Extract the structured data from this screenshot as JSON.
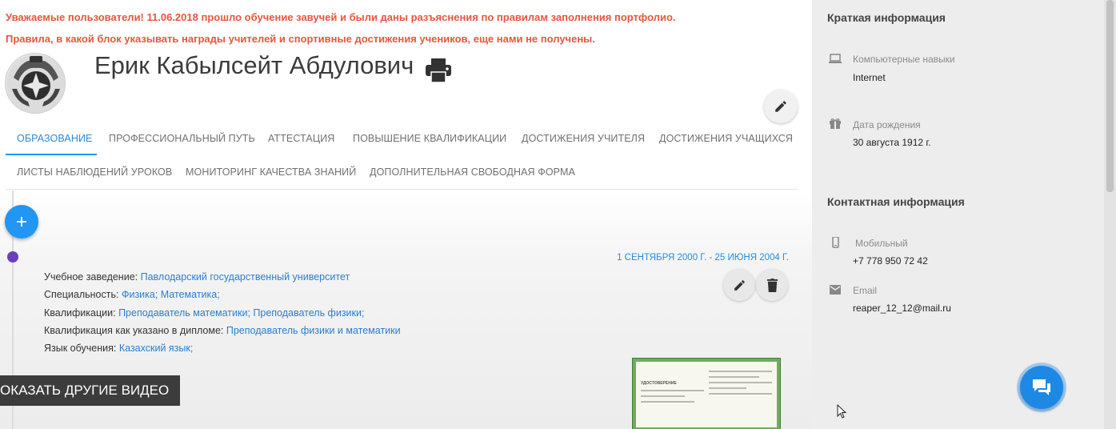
{
  "notices": [
    "Уважаемые пользователи! 11.06.2018 прошло обучение завучей и были даны разъяснения по правилам заполнения портфолио.",
    "Правила, в какой блок указывать награды учителей и спортивные достижения учеников, еще нами не получены."
  ],
  "profile": {
    "name": "Ерик Кабылсейт Абдулович",
    "print_icon": "print-icon",
    "edit_icon": "pencil-icon"
  },
  "tabs": [
    {
      "label": "ОБРАЗОВАНИЕ",
      "active": true
    },
    {
      "label": "ПРОФЕССИОНАЛЬНЫЙ ПУТЬ",
      "active": false
    },
    {
      "label": "АТТЕСТАЦИЯ",
      "active": false
    },
    {
      "label": "ПОВЫШЕНИЕ КВАЛИФИКАЦИИ",
      "active": false
    },
    {
      "label": "ДОСТИЖЕНИЯ УЧИТЕЛЯ",
      "active": false
    },
    {
      "label": "ДОСТИЖЕНИЯ УЧАЩИХСЯ",
      "active": false
    },
    {
      "label": "ЛИСТЫ НАБЛЮДЕНИЙ УРОКОВ",
      "active": false
    },
    {
      "label": "МОНИТОРИНГ КАЧЕСТВА ЗНАНИЙ",
      "active": false
    },
    {
      "label": "ДОПОЛНИТЕЛЬНАЯ СВОБОДНАЯ ФОРМА",
      "active": false
    }
  ],
  "education_entry": {
    "date_range": "1 СЕНТЯБРЯ 2000 Г. - 25 ИЮНЯ 2004 Г.",
    "fields": [
      {
        "label": "Учебное заведение:",
        "value": "Павлодарский государственный университет"
      },
      {
        "label": "Специальность:",
        "value": "Физика; Математика;"
      },
      {
        "label": "Квалификации:",
        "value": "Преподаватель математики; Преподаватель физики;"
      },
      {
        "label": "Квалификация как указано в дипломе:",
        "value": "Преподаватель физики и математики"
      },
      {
        "label": "Язык обучения:",
        "value": "Казахский язык;"
      }
    ],
    "certificate_title": "УДОСТОВЕРЕНИЕ"
  },
  "video_overlay": "ОКАЗАТЬ ДРУГИЕ ВИДЕО",
  "sidebar": {
    "brief_heading": "Краткая информация",
    "computer_skills": {
      "label": "Компьютерные навыки",
      "value": "Internet",
      "icon": "laptop-icon"
    },
    "birthday": {
      "label": "Дата рождения",
      "value": "30 августа 1912 г.",
      "icon": "gift-icon"
    },
    "contact_heading": "Контактная информация",
    "mobile": {
      "label": "Мобильный",
      "value": "+7 778 950 72 42",
      "icon": "phone-icon"
    },
    "email": {
      "label": "Email",
      "value": "reaper_12_12@mail.ru",
      "icon": "email-icon"
    }
  },
  "colors": {
    "accent": "#2196f3",
    "notice": "#e8553e",
    "timeline_dot": "#6a3fbf",
    "chat": "#1e88e5"
  }
}
